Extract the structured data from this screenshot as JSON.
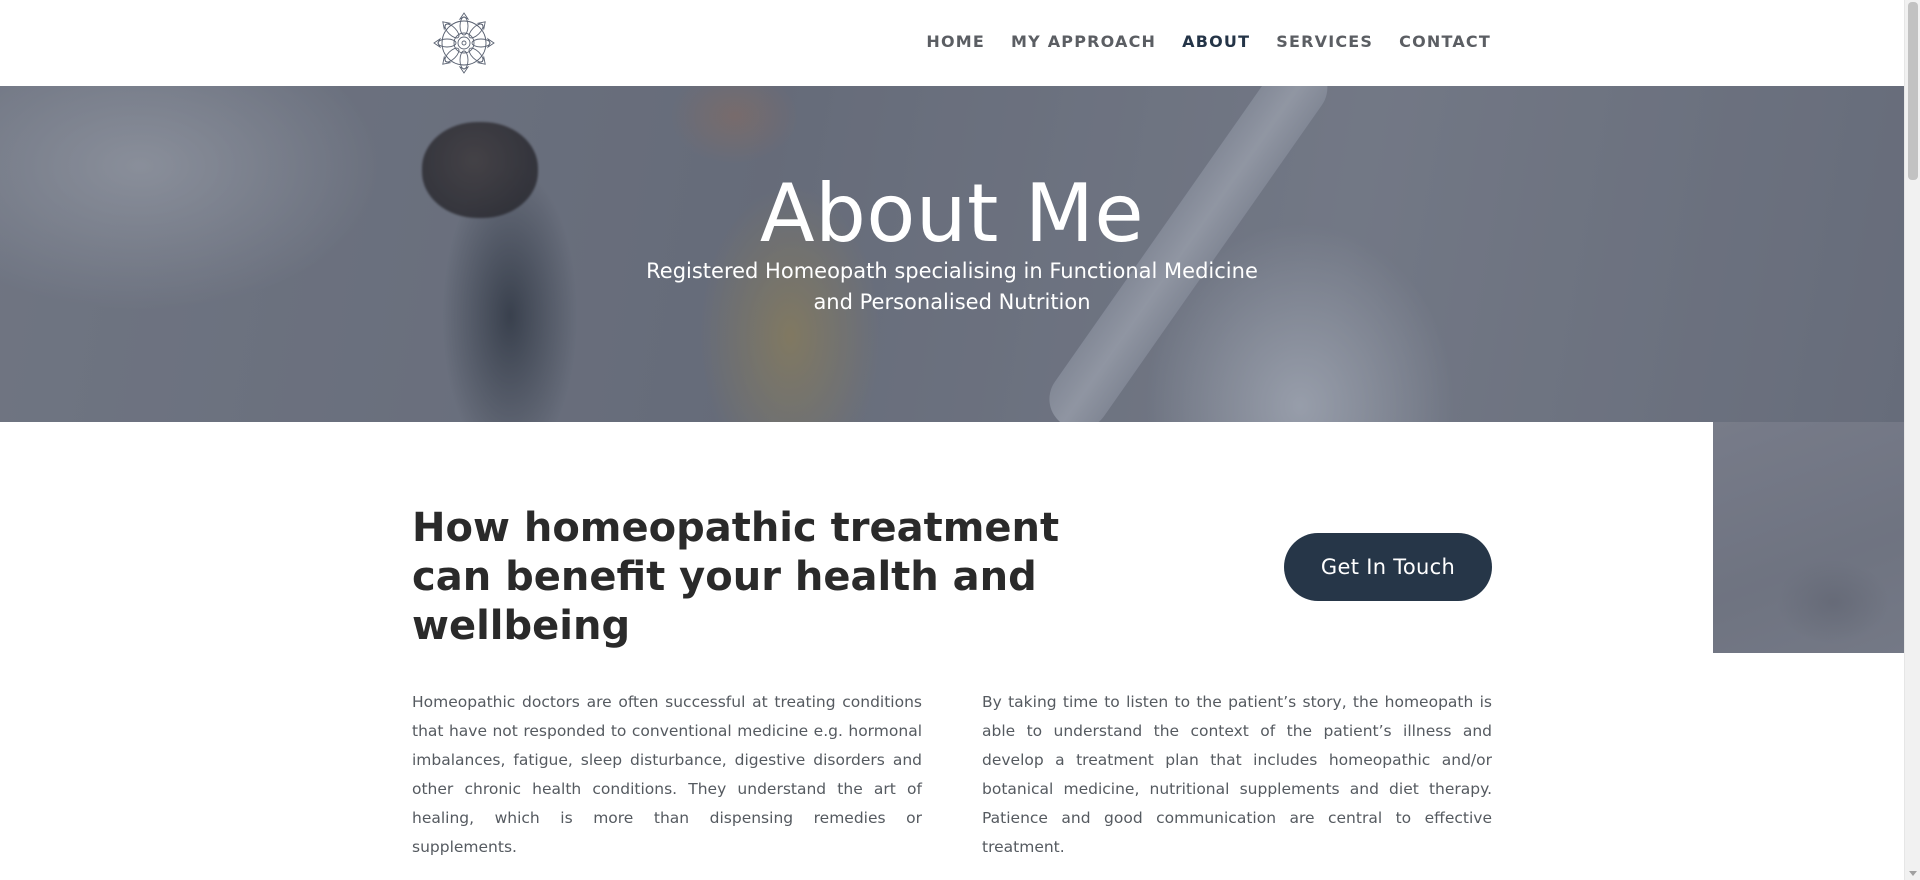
{
  "nav": {
    "items": [
      {
        "label": "HOME",
        "active": false
      },
      {
        "label": "MY APPROACH",
        "active": false
      },
      {
        "label": "ABOUT",
        "active": true
      },
      {
        "label": "SERVICES",
        "active": false
      },
      {
        "label": "CONTACT",
        "active": false
      }
    ]
  },
  "hero": {
    "title": "About Me",
    "subtitle_line1": "Registered Homeopath specialising in Functional Medicine",
    "subtitle_line2": "and Personalised Nutrition"
  },
  "main": {
    "heading": "How homeopathic treatment can benefit your health and wellbeing",
    "cta_label": "Get In Touch",
    "paragraph_left": "Homeopathic doctors are often successful at treating conditions that have not responded to conventional medicine e.g. hormonal imbalances, fatigue, sleep disturbance, digestive disorders and other chronic health conditions. They understand the art of healing, which is more than dispensing remedies or supplements.",
    "paragraph_right": "By taking time to listen to the patient’s story, the homeopath is able to understand the context of the patient’s illness and develop a treatment plan that includes homeopathic and/or botanical medicine, nutritional supplements and diet therapy. Patience and good communication are central to effective treatment."
  },
  "colors": {
    "accent": "#263648",
    "nav_text": "#5b5e63",
    "heading_text": "#2a2a2a",
    "body_text": "#555a60"
  },
  "icons": {
    "logo": "mandala-logo-icon"
  }
}
